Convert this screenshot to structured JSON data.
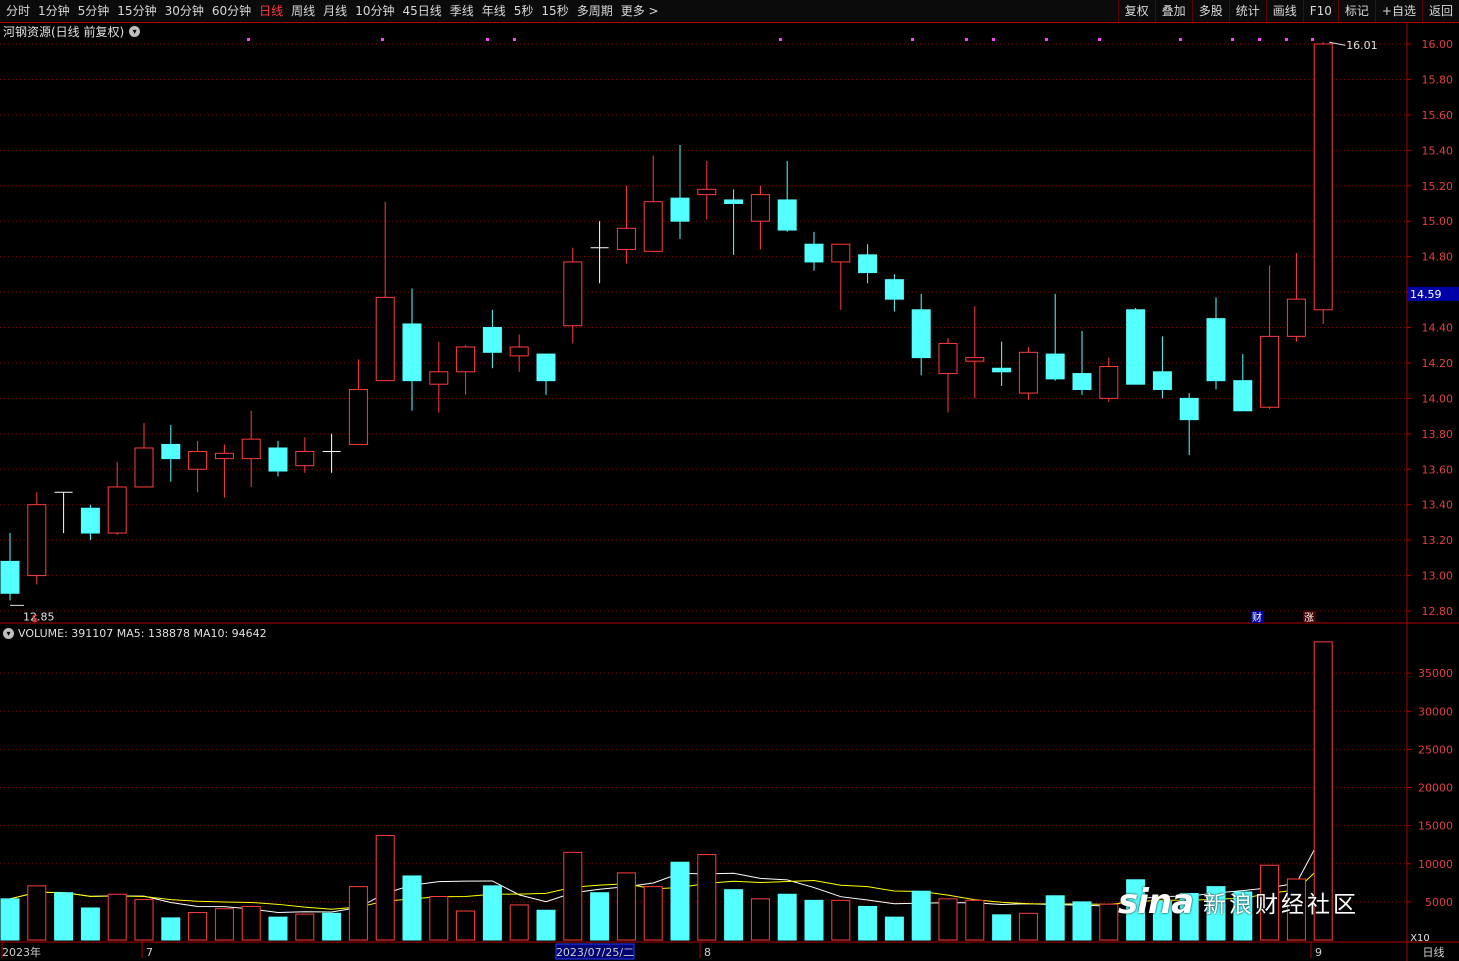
{
  "toolbar": {
    "periods": [
      "分时",
      "1分钟",
      "5分钟",
      "15分钟",
      "30分钟",
      "60分钟",
      "日线",
      "周线",
      "月线",
      "10分钟",
      "45日线",
      "季线",
      "年线",
      "5秒",
      "15秒",
      "多周期",
      "更多 >"
    ],
    "active": "日线",
    "right_buttons": [
      "复权",
      "叠加",
      "多股",
      "统计",
      "画线",
      "F10",
      "标记",
      "+自选",
      "返回"
    ]
  },
  "stock_title": "河钢资源(日线 前复权)",
  "volume_legend": "VOLUME: 391107  MA5: 138878  MA10: 94642",
  "current_price_tag": "14.59",
  "period_label_bottom": "日线",
  "volume_unit_label": "X10",
  "watermark": "新浪财经社区",
  "colors": {
    "up": "#ff3c3c",
    "down": "#54ffff",
    "grid": "#7a0000",
    "ma5": "#ffffff",
    "ma10": "#ffff00"
  },
  "chart_data": {
    "type": "candlestick",
    "price_axis": {
      "min": 12.8,
      "max": 16.0,
      "ticks": [
        "16.00",
        "15.80",
        "15.60",
        "15.40",
        "15.20",
        "15.00",
        "14.80",
        "14.60",
        "14.40",
        "14.20",
        "14.00",
        "13.80",
        "13.60",
        "13.40",
        "13.20",
        "13.00",
        "12.80"
      ]
    },
    "volume_axis": {
      "ticks": [
        "35000",
        "30000",
        "25000",
        "20000",
        "15000",
        "10000",
        "5000"
      ],
      "max": 40000
    },
    "x_labels": [
      "2023年",
      "7",
      "2023/07/25/二",
      "8",
      "9"
    ],
    "annotations": {
      "high_label": "16.01",
      "low_label": "12.85",
      "markers": [
        "$",
        "财",
        "涨"
      ]
    },
    "candles": [
      {
        "o": 13.08,
        "h": 13.24,
        "l": 12.86,
        "c": 12.9,
        "v": 5400
      },
      {
        "o": 13.0,
        "h": 13.47,
        "l": 12.95,
        "c": 13.4,
        "v": 7100
      },
      {
        "o": 13.47,
        "h": 13.47,
        "l": 13.24,
        "c": 13.47,
        "v": 6200
      },
      {
        "o": 13.38,
        "h": 13.4,
        "l": 13.2,
        "c": 13.24,
        "v": 4200
      },
      {
        "o": 13.24,
        "h": 13.64,
        "l": 13.23,
        "c": 13.5,
        "v": 6000
      },
      {
        "o": 13.5,
        "h": 13.86,
        "l": 13.5,
        "c": 13.72,
        "v": 5300
      },
      {
        "o": 13.74,
        "h": 13.85,
        "l": 13.53,
        "c": 13.66,
        "v": 2900
      },
      {
        "o": 13.6,
        "h": 13.76,
        "l": 13.47,
        "c": 13.7,
        "v": 3600
      },
      {
        "o": 13.66,
        "h": 13.74,
        "l": 13.44,
        "c": 13.69,
        "v": 4100
      },
      {
        "o": 13.66,
        "h": 13.93,
        "l": 13.5,
        "c": 13.77,
        "v": 4400
      },
      {
        "o": 13.72,
        "h": 13.76,
        "l": 13.56,
        "c": 13.59,
        "v": 3000
      },
      {
        "o": 13.62,
        "h": 13.78,
        "l": 13.58,
        "c": 13.7,
        "v": 3400
      },
      {
        "o": 13.7,
        "h": 13.8,
        "l": 13.58,
        "c": 13.7,
        "v": 3500
      },
      {
        "o": 13.74,
        "h": 14.22,
        "l": 13.74,
        "c": 14.05,
        "v": 7000
      },
      {
        "o": 14.1,
        "h": 15.11,
        "l": 14.1,
        "c": 14.57,
        "v": 13700
      },
      {
        "o": 14.42,
        "h": 14.62,
        "l": 13.93,
        "c": 14.1,
        "v": 8400
      },
      {
        "o": 14.08,
        "h": 14.32,
        "l": 13.92,
        "c": 14.15,
        "v": 5700
      },
      {
        "o": 14.15,
        "h": 14.3,
        "l": 14.02,
        "c": 14.29,
        "v": 3800
      },
      {
        "o": 14.4,
        "h": 14.5,
        "l": 14.17,
        "c": 14.26,
        "v": 7100
      },
      {
        "o": 14.24,
        "h": 14.36,
        "l": 14.15,
        "c": 14.29,
        "v": 4600
      },
      {
        "o": 14.25,
        "h": 14.25,
        "l": 14.02,
        "c": 14.1,
        "v": 3900
      },
      {
        "o": 14.41,
        "h": 14.85,
        "l": 14.31,
        "c": 14.77,
        "v": 11500
      },
      {
        "o": 14.85,
        "h": 15.0,
        "l": 14.65,
        "c": 14.85,
        "v": 6200
      },
      {
        "o": 14.84,
        "h": 15.2,
        "l": 14.76,
        "c": 14.96,
        "v": 8800
      },
      {
        "o": 14.83,
        "h": 15.37,
        "l": 14.83,
        "c": 15.11,
        "v": 7000
      },
      {
        "o": 15.13,
        "h": 15.43,
        "l": 14.9,
        "c": 15.0,
        "v": 10200
      },
      {
        "o": 15.15,
        "h": 15.34,
        "l": 15.01,
        "c": 15.18,
        "v": 11200
      },
      {
        "o": 15.12,
        "h": 15.18,
        "l": 14.81,
        "c": 15.1,
        "v": 6600
      },
      {
        "o": 15.0,
        "h": 15.2,
        "l": 14.84,
        "c": 15.15,
        "v": 5400
      },
      {
        "o": 15.12,
        "h": 15.34,
        "l": 14.94,
        "c": 14.95,
        "v": 6000
      },
      {
        "o": 14.87,
        "h": 14.94,
        "l": 14.72,
        "c": 14.77,
        "v": 5200
      },
      {
        "o": 14.77,
        "h": 14.87,
        "l": 14.5,
        "c": 14.87,
        "v": 5200
      },
      {
        "o": 14.81,
        "h": 14.87,
        "l": 14.65,
        "c": 14.71,
        "v": 4400
      },
      {
        "o": 14.67,
        "h": 14.7,
        "l": 14.49,
        "c": 14.56,
        "v": 3000
      },
      {
        "o": 14.5,
        "h": 14.59,
        "l": 14.13,
        "c": 14.23,
        "v": 6400
      },
      {
        "o": 14.14,
        "h": 14.34,
        "l": 13.92,
        "c": 14.31,
        "v": 5400
      },
      {
        "o": 14.21,
        "h": 14.52,
        "l": 14.0,
        "c": 14.23,
        "v": 5200
      },
      {
        "o": 14.17,
        "h": 14.32,
        "l": 14.07,
        "c": 14.15,
        "v": 3300
      },
      {
        "o": 14.03,
        "h": 14.29,
        "l": 13.99,
        "c": 14.26,
        "v": 3500
      },
      {
        "o": 14.25,
        "h": 14.59,
        "l": 14.1,
        "c": 14.11,
        "v": 5800
      },
      {
        "o": 14.14,
        "h": 14.38,
        "l": 14.02,
        "c": 14.05,
        "v": 5000
      },
      {
        "o": 14.0,
        "h": 14.23,
        "l": 13.98,
        "c": 14.18,
        "v": 4700
      },
      {
        "o": 14.5,
        "h": 14.51,
        "l": 14.08,
        "c": 14.08,
        "v": 7900
      },
      {
        "o": 14.15,
        "h": 14.35,
        "l": 14.0,
        "c": 14.05,
        "v": 5100
      },
      {
        "o": 14.0,
        "h": 14.03,
        "l": 13.68,
        "c": 13.88,
        "v": 6100
      },
      {
        "o": 14.45,
        "h": 14.57,
        "l": 14.05,
        "c": 14.1,
        "v": 7000
      },
      {
        "o": 14.1,
        "h": 14.25,
        "l": 13.93,
        "c": 13.93,
        "v": 6300
      },
      {
        "o": 13.95,
        "h": 14.75,
        "l": 13.94,
        "c": 14.35,
        "v": 9800
      },
      {
        "o": 14.35,
        "h": 14.82,
        "l": 14.32,
        "c": 14.56,
        "v": 8000
      },
      {
        "o": 14.5,
        "h": 16.01,
        "l": 14.42,
        "c": 16.0,
        "v": 39100
      }
    ]
  }
}
